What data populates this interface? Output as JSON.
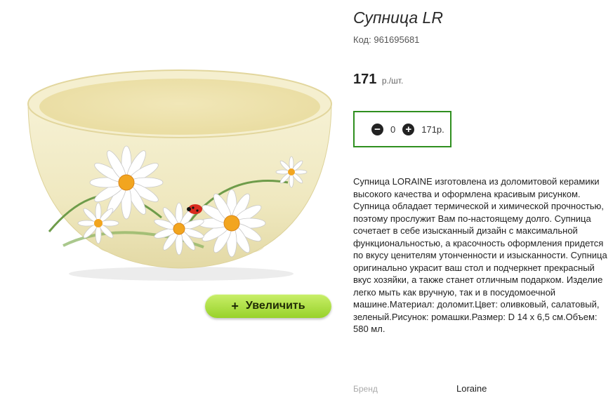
{
  "product": {
    "title": "Супница LR",
    "code_label": "Код:",
    "code_value": "961695681",
    "price_value": "171",
    "price_unit": "р./шт.",
    "description": "Супница LORAINE изготовлена из доломитовой керамики высокого качества и оформлена красивым рисунком. Супница обладает термической и химической прочностью, поэтому прослужит Вам по-настоящему долго. Супница сочетает в себе изысканный дизайн с максимальной функциональностью, а красочность оформления придется по вкусу ценителям утонченности и изысканности. Супница оригинально украсит ваш стол и подчеркнет прекрасный вкус хозяйки, а также станет отличным подарком. Изделие легко мыть как вручную, так и в посудомоечной машине.Материал: доломит.Цвет: оливковый, салатовый, зеленый.Рисунок: ромашки.Размер: D 14 х 6,5 см.Объем: 580 мл.",
    "brand_label": "Бренд",
    "brand_value": "Loraine"
  },
  "quantity": {
    "minus_icon": "minus-circle-icon",
    "plus_icon": "plus-circle-icon",
    "value": "0",
    "total": "171р."
  },
  "zoom_button": {
    "icon": "plus",
    "label": "Увеличить"
  },
  "colors": {
    "qty_border": "#2f8f1f",
    "zoom_button_green": "#a8dc3a",
    "bowl_cream": "#f3edc6"
  }
}
